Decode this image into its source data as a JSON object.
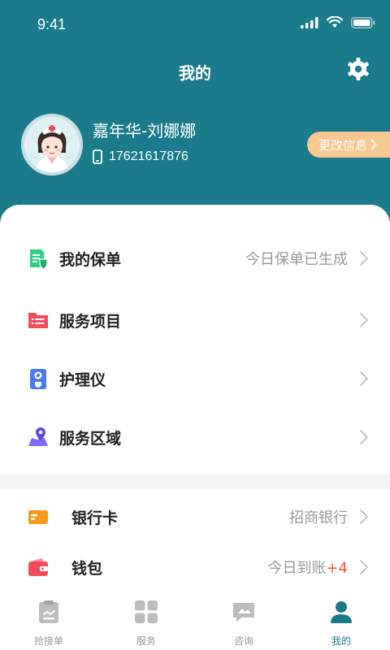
{
  "status_bar": {
    "time": "9:41"
  },
  "header": {
    "title": "我的"
  },
  "profile": {
    "name": "嘉年华-刘娜娜",
    "phone": "17621617876",
    "edit_label": "更改信息"
  },
  "menu": [
    {
      "label": "我的保单",
      "value": "今日保单已生成",
      "icon": "policy-icon"
    },
    {
      "label": "服务项目",
      "value": "",
      "icon": "service-list-icon"
    },
    {
      "label": "护理仪",
      "value": "",
      "icon": "care-device-icon"
    },
    {
      "label": "服务区域",
      "value": "",
      "icon": "service-area-icon"
    }
  ],
  "finance": [
    {
      "label": "银行卡",
      "value": "招商银行",
      "icon": "bank-card-icon"
    },
    {
      "label": "钱包",
      "value": "今日到账",
      "value_extra": "+4",
      "icon": "wallet-icon"
    }
  ],
  "tabs": [
    {
      "label": "抢接单",
      "icon": "grab-order-icon",
      "active": false
    },
    {
      "label": "服务",
      "icon": "services-grid-icon",
      "active": false
    },
    {
      "label": "咨询",
      "icon": "consult-icon",
      "active": false
    },
    {
      "label": "我的",
      "icon": "profile-icon",
      "active": true
    }
  ],
  "colors": {
    "header_bg": "#1b7b8b",
    "edit_button": "#f8c891",
    "accent_red": "#f0553a"
  }
}
